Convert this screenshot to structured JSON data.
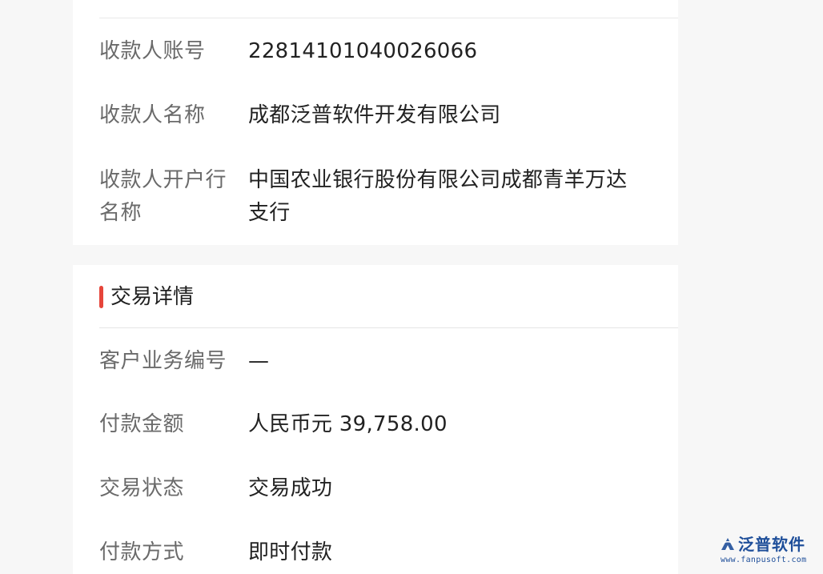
{
  "payee_section": {
    "rows": [
      {
        "label": "收款人账号",
        "value": "22814101040026066"
      },
      {
        "label": "收款人名称",
        "value": "成都泛普软件开发有限公司"
      },
      {
        "label": "收款人开户行名称",
        "value": "中国农业银行股份有限公司成都青羊万达支行"
      }
    ]
  },
  "transaction_section": {
    "title": "交易详情",
    "accent_color": "#e6453a",
    "rows": [
      {
        "label": "客户业务编号",
        "value": "—"
      },
      {
        "label": "付款金额",
        "value": "人民币元 39,758.00"
      },
      {
        "label": "交易状态",
        "value": "交易成功"
      },
      {
        "label": "付款方式",
        "value": "即时付款"
      }
    ]
  },
  "watermark": {
    "name": "泛普软件",
    "url": "www.fanpusoft.com",
    "color": "#1f4f9a"
  }
}
